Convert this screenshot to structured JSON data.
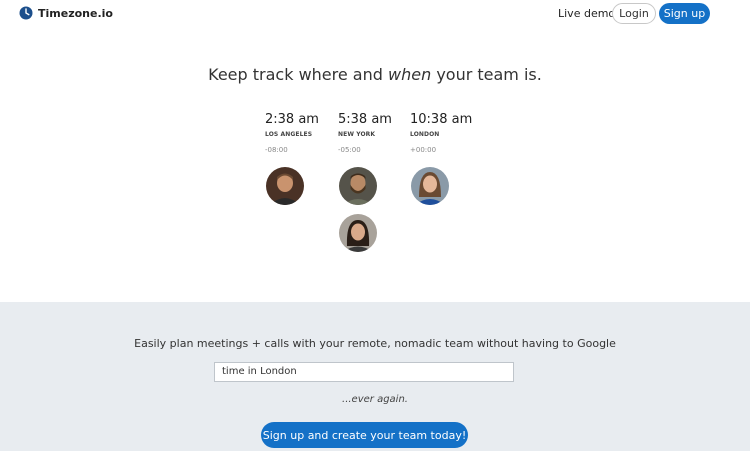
{
  "nav": {
    "brand_name": "Timezone.io",
    "brand_icon": "clock-icon",
    "live_demo": "Live demo",
    "login": "Login",
    "signup": "Sign up"
  },
  "hero": {
    "headline_before": "Keep track where and",
    "headline_emphasis": "when",
    "headline_after": "your team is."
  },
  "timezones": [
    {
      "time": "2:38 am",
      "city": "LOS ANGELES",
      "offset": "-08:00"
    },
    {
      "time": "5:38 am",
      "city": "NEW YORK",
      "offset": "-05:00"
    },
    {
      "time": "10:38 am",
      "city": "LONDON",
      "offset": "+00:00"
    }
  ],
  "bottom": {
    "tagline": "Easily plan meetings + calls with your remote, nomadic team without having to Google",
    "search_value": "time in London",
    "ever_again": "...ever again.",
    "cta": "Sign up and create your team today!"
  },
  "colors": {
    "accent": "#1471c7",
    "bottom_bg": "#e8ecf0"
  }
}
